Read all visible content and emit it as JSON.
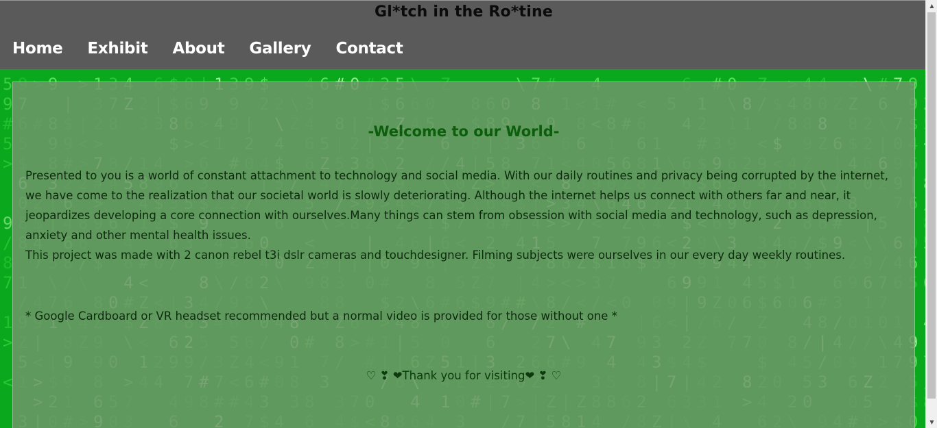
{
  "site": {
    "title": "Gl*tch in the Ro*tine"
  },
  "nav": {
    "items": [
      {
        "label": "Home"
      },
      {
        "label": "Exhibit"
      },
      {
        "label": "About"
      },
      {
        "label": "Gallery"
      },
      {
        "label": "Contact"
      }
    ]
  },
  "main": {
    "heading": "-Welcome to our World-",
    "paragraph1": "Presented to you is a world of constant attachment to technology and social media. With our daily routines and privacy being corrupted by the internet, we have come to the realization that our societal world is slowly deteriorating. Although the internet helps us connect with others far and near, it jeopardizes developing a core connection with ourselves.Many things can stem from obsession with social media and technology, such as depression, anxiety and other mental health issues.",
    "paragraph2": "This project was made with 2 canon rebel t3i dslr cameras and touchdesigner. Filming subjects were ourselves in our every day weekly routines.",
    "note": "* Google Cardboard or VR headset recommended but a normal video is provided for those without one *",
    "thanks": "♡ ❣ ❤Thank you for visiting❤ ❣ ♡"
  },
  "scrollbar": {
    "up_icon": "▲",
    "down_icon": "▼"
  },
  "colors": {
    "header_bg": "#5a5a5a",
    "matrix_green": "#0aa81d",
    "heading_green": "#0c5e0c"
  }
}
